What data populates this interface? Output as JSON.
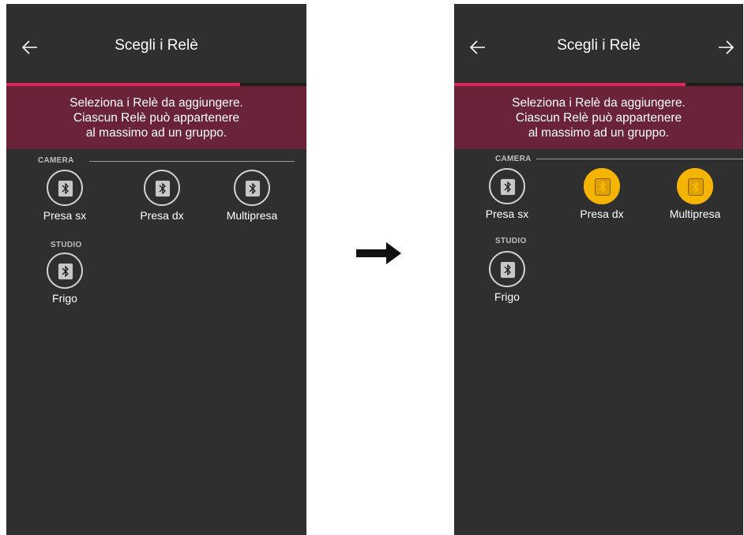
{
  "screens": [
    {
      "header": {
        "title": "Scegli i Relè",
        "back_icon": "arrow-left-icon",
        "forward_icon": null
      },
      "progress": {
        "fraction": 0.78,
        "fill_color": "#e0245e"
      },
      "banner": {
        "lines": [
          "Seleziona i Relè da aggiungere.",
          "Ciascun Relè può appartenere",
          "al massimo ad un gruppo."
        ],
        "color": "#6b2339"
      },
      "groups": [
        {
          "label": "CAMERA",
          "devices": [
            {
              "label": "Presa sx",
              "icon": "bluetooth-icon",
              "selected": false
            },
            {
              "label": "Presa dx",
              "icon": "bluetooth-icon",
              "selected": false
            },
            {
              "label": "Multipresa",
              "icon": "bluetooth-icon",
              "selected": false
            }
          ]
        },
        {
          "label": "STUDIO",
          "devices": [
            {
              "label": "Frigo",
              "icon": "bluetooth-icon",
              "selected": false
            }
          ]
        }
      ]
    },
    {
      "header": {
        "title": "Scegli i Relè",
        "back_icon": "arrow-left-icon",
        "forward_icon": "arrow-right-icon"
      },
      "progress": {
        "fraction": 0.8,
        "fill_color": "#e0245e"
      },
      "banner": {
        "lines": [
          "Seleziona i Relè da aggiungere.",
          "Ciascun Relè può appartenere",
          "al massimo ad un gruppo."
        ],
        "color": "#6b2339"
      },
      "groups": [
        {
          "label": "CAMERA",
          "devices": [
            {
              "label": "Presa sx",
              "icon": "bluetooth-icon",
              "selected": false
            },
            {
              "label": "Presa dx",
              "icon": "bluetooth-icon",
              "selected": true
            },
            {
              "label": "Multipresa",
              "icon": "bluetooth-icon",
              "selected": true
            }
          ]
        },
        {
          "label": "STUDIO",
          "devices": [
            {
              "label": "Frigo",
              "icon": "bluetooth-icon",
              "selected": false
            }
          ]
        }
      ]
    }
  ],
  "transition_icon": "arrow-right-icon",
  "colors": {
    "background": "#2f2f2f",
    "selected": "#f5b400",
    "accent": "#e0245e"
  }
}
